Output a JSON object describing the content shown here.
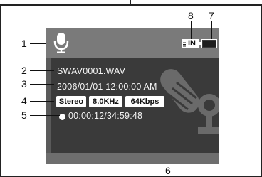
{
  "callouts": {
    "c1": "1",
    "c2": "2",
    "c3": "3",
    "c4": "4",
    "c5": "5",
    "c6": "6",
    "c7": "7",
    "c8": "8"
  },
  "screen": {
    "filename": "SWAV0001.WAV",
    "datetime": "2006/01/01 12:00:00 AM",
    "badges": {
      "channel": "Stereo",
      "sample_rate": "8.0KHz",
      "bitrate": "64Kbps"
    },
    "time_display": "00:00:12/34:59:48",
    "memory_indicator": "IN"
  },
  "icons": {
    "mode": "microphone-icon",
    "memory": "internal-memory-icon",
    "battery": "battery-icon",
    "status": "record-dot-icon",
    "background": "microphone-watermark"
  },
  "colors": {
    "screen_bg": "#5a5a5a",
    "panel_bg": "#3a3a3a",
    "osd_text": "#f4f4f4",
    "badge_bg": "#ffffff"
  }
}
